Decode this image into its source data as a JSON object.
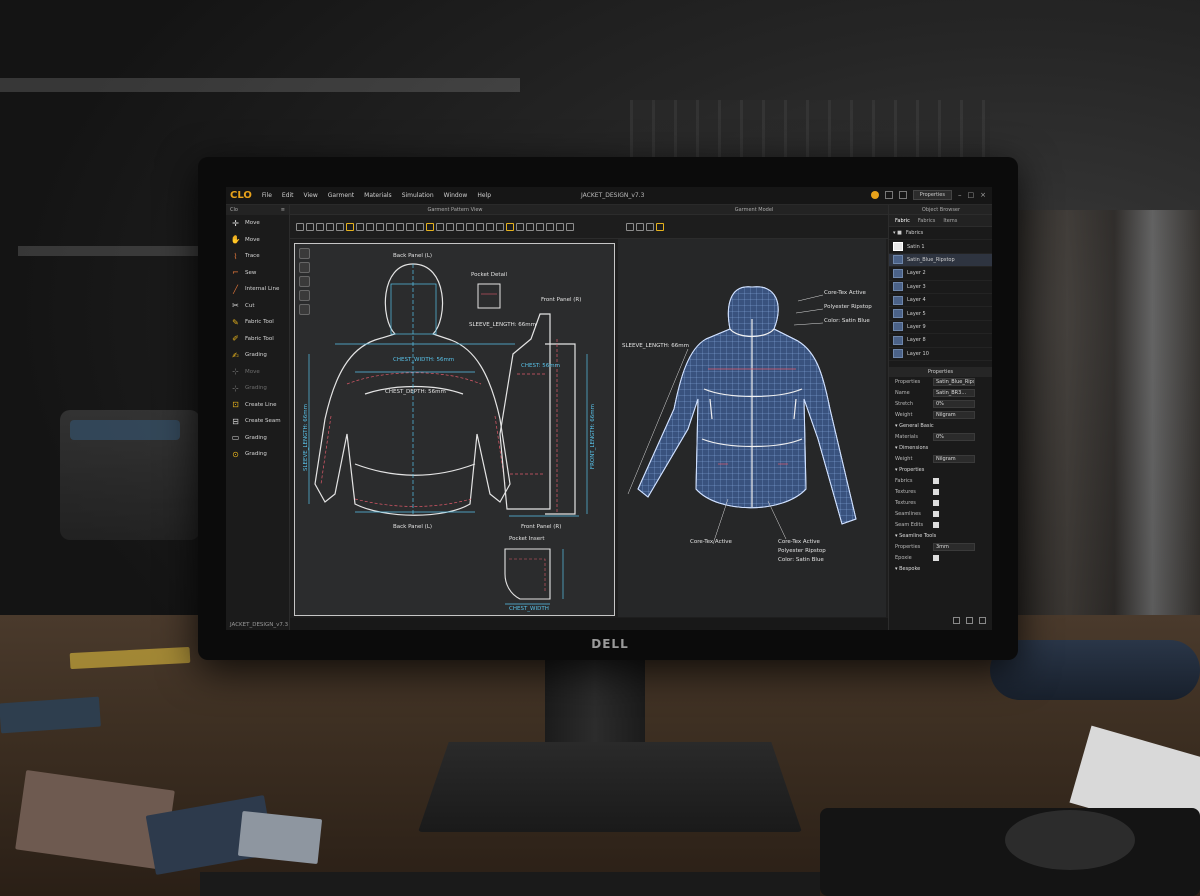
{
  "app": {
    "logo": "CLO",
    "title": "JACKET_DESIGN_v7.3",
    "menu": [
      "File",
      "Edit",
      "View",
      "Garment",
      "Materials",
      "Simulation",
      "Window",
      "Help"
    ],
    "top_button": "Properties",
    "status_file": "JACKET_DESIGN_v7.3"
  },
  "left_panel": {
    "header": "Clo",
    "tools": [
      {
        "label": "Move",
        "icon": "move-icon",
        "dim": false
      },
      {
        "label": "Move",
        "icon": "hand-icon",
        "dim": false
      },
      {
        "label": "Trace",
        "icon": "trace-icon",
        "dim": false
      },
      {
        "label": "Sew",
        "icon": "sew-icon",
        "dim": false
      },
      {
        "label": "Internal Line",
        "icon": "internal-line-icon",
        "dim": false
      },
      {
        "label": "Cut",
        "icon": "scissors-icon",
        "dim": false
      },
      {
        "label": "Fabric Tool",
        "icon": "fabric-icon",
        "dim": false
      },
      {
        "label": "Fabric Tool",
        "icon": "fabric-tool-icon",
        "dim": false
      },
      {
        "label": "Grading",
        "icon": "grading-icon",
        "dim": false
      },
      {
        "label": "Move",
        "icon": "move-dim-icon",
        "dim": true
      },
      {
        "label": "Grading",
        "icon": "grading-dim-icon",
        "dim": true
      },
      {
        "label": "Create Line",
        "icon": "create-line-icon",
        "dim": false
      },
      {
        "label": "Create Seam",
        "icon": "create-seam-icon",
        "dim": false
      },
      {
        "label": "Grading",
        "icon": "grading-2-icon",
        "dim": false
      },
      {
        "label": "Grading",
        "icon": "grading-3-icon",
        "dim": false
      }
    ]
  },
  "views": {
    "pattern_header": "Garment Pattern View",
    "model_header": "Garment Model",
    "pattern_labels": {
      "back_panel_top": "Back Panel (L)",
      "pocket_detail": "Pocket Detail",
      "front_panel_top": "Front Panel (R)",
      "sleeve_length": "SLEEVE_LENGTH: 66mm",
      "chest": "CHEST_WIDTH: 56mm",
      "chest_2": "CHEST_DEPTH: 56mm",
      "chest_front": "CHEST: 56mm",
      "sleeve_vert": "SLEEVE_LENGTH: 66mm",
      "front_vert": "FRONT_LENGTH: 66mm",
      "back_panel_bottom": "Back Panel (L)",
      "front_panel_bottom": "Front Panel (R)",
      "pocket_bottom": "Pocket Insert",
      "chest_width": "CHEST_WIDTH"
    },
    "model_labels": {
      "sleeve_length": "SLEEVE_LENGTH: 66mm",
      "core_tex": "Core-Tex Active",
      "polyester": "Polyester Ripstop",
      "color": "Color: Satin Blue",
      "bottom_1": "Core-Tex Active",
      "bottom_2": "Core-Tex Active",
      "bottom_3": "Polyester Ripstop",
      "bottom_4": "Color: Satin Blue"
    }
  },
  "right_panel": {
    "header": "Object Browser",
    "tabs": [
      "Fabric",
      "Fabrics",
      "Items"
    ],
    "tree_root": "Fabrics",
    "layers": [
      {
        "label": "Satin 1",
        "white": true,
        "sel": false
      },
      {
        "label": "Satin_Blue_Ripstop",
        "white": false,
        "sel": true
      },
      {
        "label": "Layer 2",
        "white": false,
        "sel": false
      },
      {
        "label": "Layer 3",
        "white": false,
        "sel": false
      },
      {
        "label": "Layer 4",
        "white": false,
        "sel": false
      },
      {
        "label": "Layer 5",
        "white": false,
        "sel": false
      },
      {
        "label": "Layer 9",
        "white": false,
        "sel": false
      },
      {
        "label": "Layer 8",
        "white": false,
        "sel": false
      },
      {
        "label": "Layer 10",
        "white": false,
        "sel": false
      }
    ],
    "properties_header": "Properties",
    "properties": [
      {
        "k": "Properties",
        "v": "Satin_Blue_Ripstop",
        "t": "val"
      },
      {
        "k": "Name",
        "v": "Satin_BR3...",
        "t": "val"
      },
      {
        "k": "Stretch",
        "v": "0%",
        "t": "val"
      },
      {
        "k": "Weight",
        "v": "Nilgram",
        "t": "val"
      },
      {
        "k": "▾ General Basic",
        "v": "",
        "t": "grp"
      },
      {
        "k": "Materials",
        "v": "0%",
        "t": "val"
      },
      {
        "k": "▾ Dimensions",
        "v": "",
        "t": "grp"
      },
      {
        "k": "Weight",
        "v": "Nilgram",
        "t": "val"
      },
      {
        "k": "▾ Properties",
        "v": "",
        "t": "grp"
      },
      {
        "k": "Fabrics",
        "v": "",
        "t": "chk"
      },
      {
        "k": "Textures",
        "v": "",
        "t": "chk"
      },
      {
        "k": "Textures",
        "v": "",
        "t": "chk"
      },
      {
        "k": "Seamlines",
        "v": "",
        "t": "chk"
      },
      {
        "k": "Seam Edits",
        "v": "",
        "t": "chk"
      },
      {
        "k": "▾ Seamline Tools",
        "v": "",
        "t": "grp"
      },
      {
        "k": "Properties",
        "v": "3mm",
        "t": "val"
      },
      {
        "k": "Epoxie",
        "v": "",
        "t": "chk"
      },
      {
        "k": "▾ Bespoke",
        "v": "",
        "t": "grp"
      }
    ]
  },
  "brand": "DELL",
  "colors": {
    "accent": "#e8a21a",
    "pattern_line": "#e4e4e4",
    "measure": "#59c3ea",
    "seam": "#e05a6a",
    "mesh": "#8fb2e8"
  }
}
